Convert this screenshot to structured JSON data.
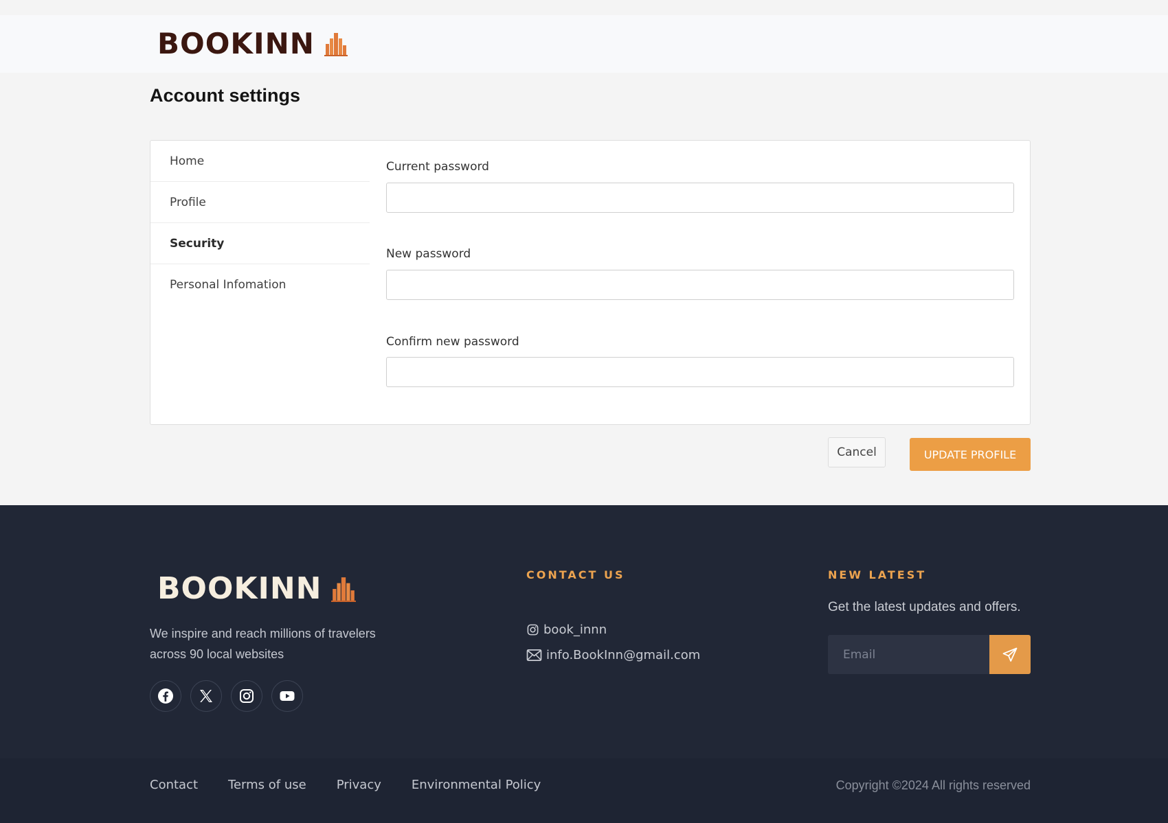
{
  "header": {
    "brand": "BOOKINN"
  },
  "page": {
    "title": "Account settings"
  },
  "side_nav": {
    "items": [
      {
        "label": "Home"
      },
      {
        "label": "Profile"
      },
      {
        "label": "Security"
      },
      {
        "label": "Personal Infomation"
      }
    ],
    "active": "Security"
  },
  "form": {
    "current_password_label": "Current password",
    "current_password_value": "",
    "new_password_label": "New password",
    "new_password_value": "",
    "confirm_password_label": "Confirm new password",
    "confirm_password_value": ""
  },
  "actions": {
    "cancel_label": "Cancel",
    "update_label": "UPDATE PROFILE"
  },
  "footer": {
    "brand": "BOOKINN",
    "tagline": "We inspire and reach millions of travelers across 90 local websites",
    "socials": [
      "facebook-icon",
      "x-icon",
      "instagram-icon",
      "youtube-icon"
    ],
    "contact_heading": "CONTACT US",
    "instagram_handle": "book_innn",
    "email": "info.BookInn@gmail.com",
    "newsletter_heading": "NEW LATEST",
    "newsletter_text": "Get the latest updates and offers.",
    "email_placeholder": "Email",
    "links": [
      "Contact",
      "Terms of use",
      "Privacy",
      "Environmental Policy"
    ],
    "copyright": "Copyright ©2024 All rights reserved"
  },
  "colors": {
    "accent": "#ec9e45",
    "brand_dark": "#3b1710",
    "footer_bg": "#212736"
  }
}
